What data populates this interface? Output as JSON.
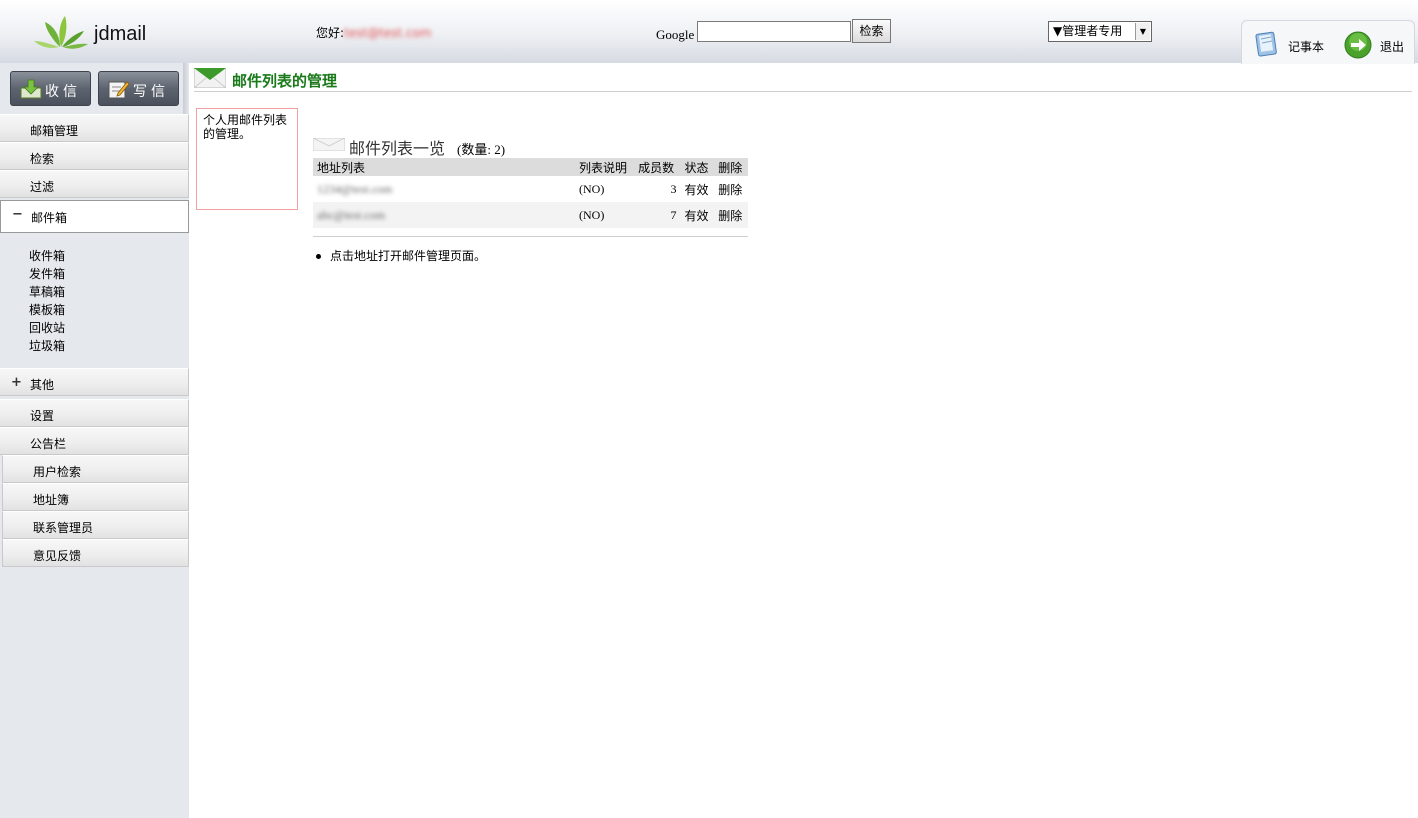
{
  "header": {
    "logo_text": "jdmail",
    "greeting_label": "您好:",
    "greeting_email": "test@test.com",
    "google_label": "Google",
    "google_input_value": "",
    "google_search_button": "检索",
    "admin_select_value": "▼管理者专用",
    "notepad_label": "记事本",
    "logout_label": "退出"
  },
  "sidebar": {
    "receive_button": "收信",
    "write_button": "写信",
    "nav": {
      "mailbox_manage": "邮箱管理",
      "search": "检索",
      "filter": "过滤",
      "mailbox_folder": "邮件箱",
      "mailbox_sign": "−",
      "other": "其他",
      "other_sign": "+",
      "settings": "设置",
      "bulletin": "公告栏",
      "user_search": "用户检索",
      "address_book": "地址簿",
      "contact_admin": "联系管理员",
      "feedback": "意见反馈"
    },
    "folders": [
      "收件箱",
      "发件箱",
      "草稿箱",
      "模板箱",
      "回收站",
      "垃圾箱"
    ]
  },
  "main": {
    "title": "邮件列表的管理",
    "help_text": "个人用邮件列表的管理。",
    "list_heading": "邮件列表一览",
    "list_count": "(数量: 2)",
    "table": {
      "headers": [
        "地址列表",
        "列表说明",
        "成员数",
        "状态",
        "删除"
      ],
      "rows": [
        {
          "address": "1234@test.com",
          "description": "(NO)",
          "members": "3",
          "status": "有效",
          "delete": "删除"
        },
        {
          "address": "abc@test.com",
          "description": "(NO)",
          "members": "7",
          "status": "有效",
          "delete": "删除"
        }
      ]
    },
    "note": "点击地址打开邮件管理页面。"
  }
}
